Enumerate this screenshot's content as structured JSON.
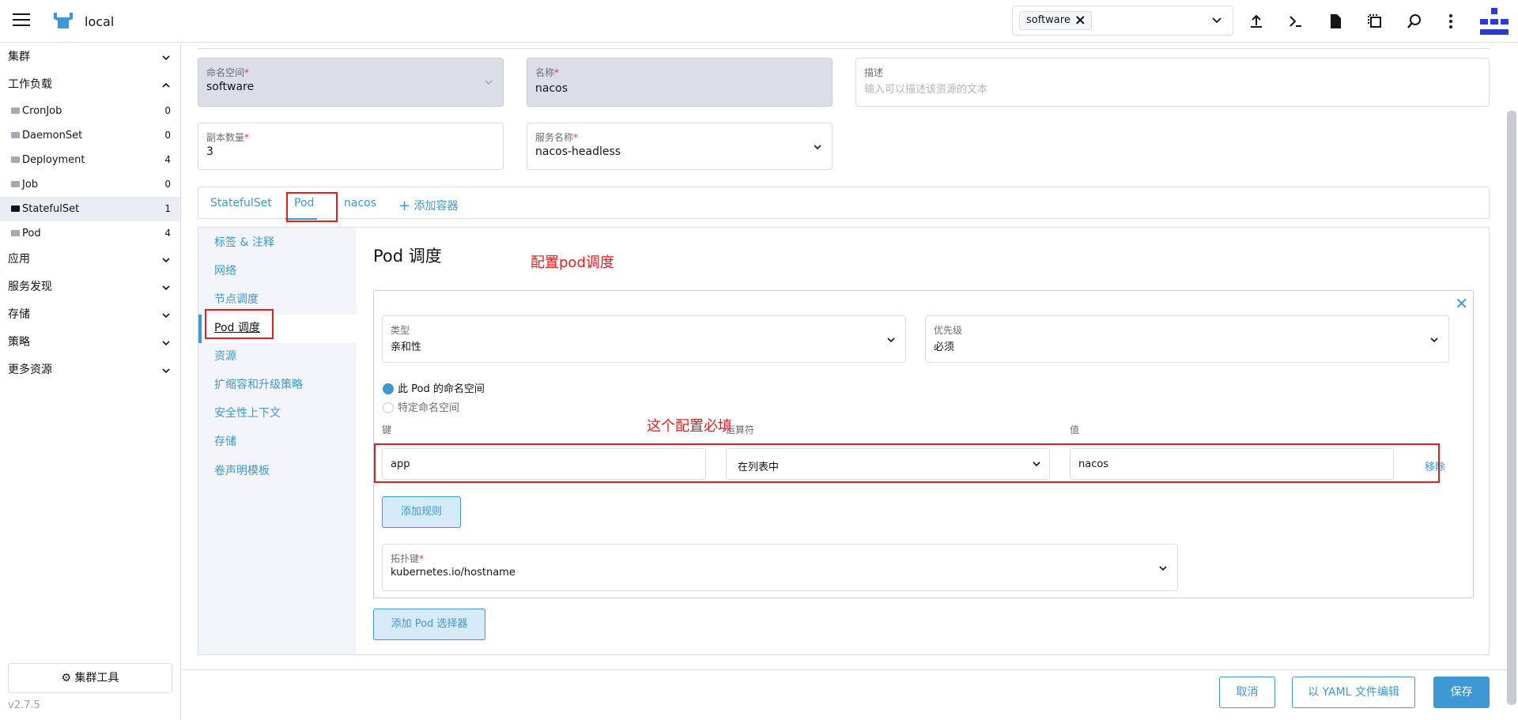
{
  "header": {
    "cluster_name": "local",
    "namespace_chip": "software",
    "icons": [
      "menu-icon",
      "cow-logo-icon",
      "upload-icon",
      "shell-icon",
      "file-icon",
      "copy-icon",
      "search-icon",
      "more-icon",
      "user-avatar-icon"
    ]
  },
  "sidebar": {
    "groups": {
      "cluster": "集群",
      "workload": "工作负载",
      "apps": "应用",
      "service_discovery": "服务发现",
      "storage": "存储",
      "policy": "策略",
      "more_resources": "更多资源"
    },
    "items": [
      {
        "label": "CronJob",
        "count": "0"
      },
      {
        "label": "DaemonSet",
        "count": "0"
      },
      {
        "label": "Deployment",
        "count": "4"
      },
      {
        "label": "Job",
        "count": "0"
      },
      {
        "label": "StatefulSet",
        "count": "1"
      },
      {
        "label": "Pod",
        "count": "4"
      }
    ],
    "tools_button": "集群工具",
    "version": "v2.7.5"
  },
  "form": {
    "namespace": {
      "label": "命名空间",
      "value": "software"
    },
    "name": {
      "label": "名称",
      "value": "nacos"
    },
    "description": {
      "label": "描述",
      "placeholder": "输入可以描述该资源的文本"
    },
    "replicas": {
      "label": "副本数量",
      "value": "3"
    },
    "service_name": {
      "label": "服务名称",
      "value": "nacos-headless"
    }
  },
  "tabs": {
    "statefulset": "StatefulSet",
    "pod": "Pod",
    "nacos": "nacos",
    "add_container": "添加容器"
  },
  "side_tabs": [
    "标签 & 注释",
    "网络",
    "节点调度",
    "Pod 调度",
    "资源",
    "扩缩容和升级策略",
    "安全性上下文",
    "存储",
    "卷声明模板"
  ],
  "pod_scheduling": {
    "title": "Pod 调度",
    "annotation_title": "配置pod调度",
    "annotation_required": "这个配置必填",
    "type": {
      "label": "类型",
      "value": "亲和性"
    },
    "priority": {
      "label": "优先级",
      "value": "必须"
    },
    "radio_this_ns": "此 Pod 的命名空间",
    "radio_specific_ns": "特定命名空间",
    "col_key": "键",
    "col_operator": "运算符",
    "col_value": "值",
    "rule": {
      "key": "app",
      "operator": "在列表中",
      "value": "nacos"
    },
    "remove": "移除",
    "add_rule": "添加规则",
    "topology": {
      "label": "拓扑键",
      "value": "kubernetes.io/hostname"
    },
    "add_pod_selector": "添加 Pod 选择器"
  },
  "footer": {
    "cancel": "取消",
    "edit_yaml": "以 YAML 文件编辑",
    "save": "保存"
  },
  "colors": {
    "accent": "#3d98d3",
    "annotation": "#e02020",
    "border": "#dcdee7"
  }
}
